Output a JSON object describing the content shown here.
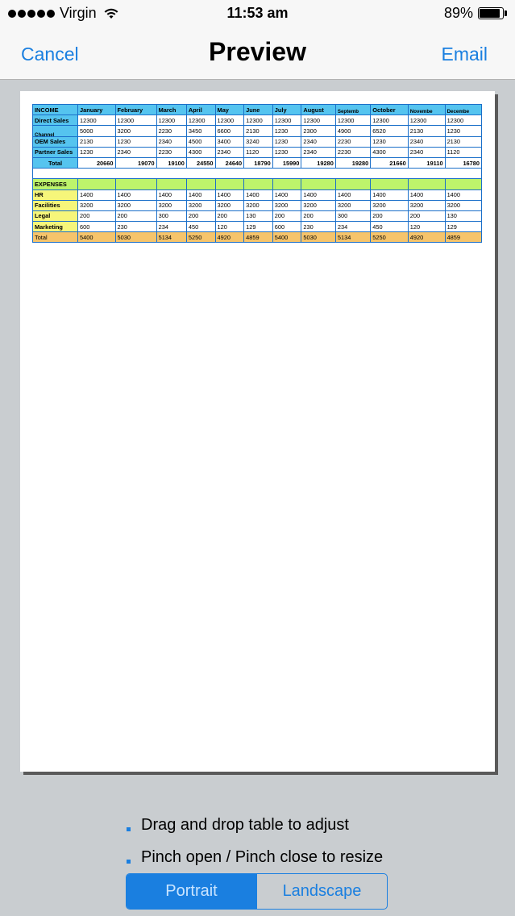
{
  "status_bar": {
    "carrier": "Virgin",
    "time": "11:53 am",
    "battery_percent": "89%",
    "battery_level": 0.89,
    "signal_icon": "signal-dots-icon",
    "wifi_icon": "wifi-icon"
  },
  "nav": {
    "cancel_label": "Cancel",
    "title": "Preview",
    "email_label": "Email"
  },
  "table": {
    "income_header": {
      "label": "INCOME",
      "months": [
        "January",
        "February",
        "March",
        "April",
        "May",
        "June",
        "July",
        "August",
        "Septemb",
        "October",
        "Novembe",
        "Decembe"
      ]
    },
    "income_rows": [
      {
        "label": "Direct Sales",
        "values": [
          "12300",
          "12300",
          "12300",
          "12300",
          "12300",
          "12300",
          "12300",
          "12300",
          "12300",
          "12300",
          "12300",
          "12300"
        ]
      },
      {
        "label": "Channel",
        "values": [
          "5000",
          "3200",
          "2230",
          "3450",
          "6600",
          "2130",
          "1230",
          "2300",
          "4900",
          "6520",
          "2130",
          "1230"
        ]
      },
      {
        "label": "OEM Sales",
        "values": [
          "2130",
          "1230",
          "2340",
          "4500",
          "3400",
          "3240",
          "1230",
          "2340",
          "2230",
          "1230",
          "2340",
          "2130"
        ]
      },
      {
        "label": "Partner Sales",
        "values": [
          "1230",
          "2340",
          "2230",
          "4300",
          "2340",
          "1120",
          "1230",
          "2340",
          "2230",
          "4300",
          "2340",
          "1120"
        ]
      }
    ],
    "income_total": {
      "label": "Total",
      "values": [
        "20660",
        "19070",
        "19100",
        "24550",
        "24640",
        "18790",
        "15990",
        "19280",
        "19280",
        "21660",
        "19110",
        "16780"
      ]
    },
    "expenses_header": {
      "label": "EXPENSES"
    },
    "expense_rows": [
      {
        "label": "HR",
        "values": [
          "1400",
          "1400",
          "1400",
          "1400",
          "1400",
          "1400",
          "1400",
          "1400",
          "1400",
          "1400",
          "1400",
          "1400"
        ]
      },
      {
        "label": "Facilities",
        "values": [
          "3200",
          "3200",
          "3200",
          "3200",
          "3200",
          "3200",
          "3200",
          "3200",
          "3200",
          "3200",
          "3200",
          "3200"
        ]
      },
      {
        "label": "Legal",
        "values": [
          "200",
          "200",
          "300",
          "200",
          "200",
          "130",
          "200",
          "200",
          "300",
          "200",
          "200",
          "130"
        ]
      },
      {
        "label": "Marketing",
        "values": [
          "600",
          "230",
          "234",
          "450",
          "120",
          "129",
          "600",
          "230",
          "234",
          "450",
          "120",
          "129"
        ]
      }
    ],
    "expense_total": {
      "label": "Total",
      "values": [
        "5400",
        "5030",
        "5134",
        "5250",
        "4920",
        "4859",
        "5400",
        "5030",
        "5134",
        "5250",
        "4920",
        "4859"
      ]
    }
  },
  "hints": [
    "Drag and drop table to adjust",
    "Pinch open / Pinch close to resize"
  ],
  "orientation": {
    "options": [
      "Portrait",
      "Landscape"
    ],
    "selected": "Portrait"
  },
  "colors": {
    "accent": "#1a7fe0",
    "income_header": "#55c4ef",
    "row_label_yellow": "#f6f67a",
    "expenses_header": "#bdf46b",
    "expense_total": "#f6c46b"
  }
}
